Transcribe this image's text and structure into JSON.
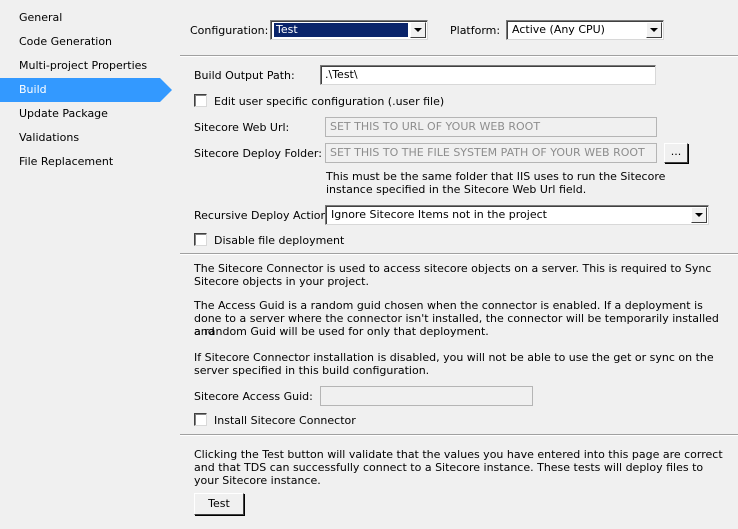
{
  "nav": {
    "items": [
      {
        "label": "General"
      },
      {
        "label": "Code Generation"
      },
      {
        "label": "Multi-project Properties"
      },
      {
        "label": "Build"
      },
      {
        "label": "Update Package"
      },
      {
        "label": "Validations"
      },
      {
        "label": "File Replacement"
      }
    ],
    "selected": "Build"
  },
  "top": {
    "configuration_label": "Configuration:",
    "configuration_value": "Test",
    "platform_label": "Platform:",
    "platform_value": "Active (Any CPU)"
  },
  "build": {
    "output_path_label": "Build Output Path:",
    "output_path_value": ".\\Test\\",
    "edit_user_config_label": "Edit user specific configuration (.user file)",
    "edit_user_config_checked": false,
    "web_url_label": "Sitecore Web Url:",
    "web_url_placeholder": "SET THIS TO URL OF YOUR WEB ROOT",
    "deploy_folder_label": "Sitecore Deploy Folder:",
    "deploy_folder_placeholder": "SET THIS TO THE FILE SYSTEM PATH OF YOUR WEB ROOT",
    "browse_label": "...",
    "deploy_folder_note_1": "This must be the same folder that IIS uses to run the Sitecore",
    "deploy_folder_note_2": "instance specified in the Sitecore Web Url field.",
    "recursive_label": "Recursive Deploy Action:",
    "recursive_value": "Ignore Sitecore Items not in the project",
    "disable_deploy_label": "Disable file deployment",
    "disable_deploy_checked": false
  },
  "connector": {
    "para1_line1": "The Sitecore Connector is used to access sitecore objects on a server. This is required to Sync",
    "para1_line2": "Sitecore objects in your project.",
    "para2_line1": "The Access Guid is a random guid chosen when the connector is enabled. If a deployment is",
    "para2_line2": "done to a server where the connector isn't installed, the connector will be temporarily installed and",
    "para2_line3": "a random Guid will be used for only that deployment.",
    "para3_line1": "If Sitecore Connector installation is disabled, you will not be able to use the get or sync on the",
    "para3_line2": "server specified in this build configuration.",
    "access_guid_label": "Sitecore Access Guid:",
    "access_guid_value": "",
    "install_label": "Install Sitecore Connector",
    "install_checked": false
  },
  "test": {
    "line1": "Clicking the Test button will validate that the values you have entered into this page are correct",
    "line2": "and that TDS can successfully connect to a Sitecore instance. These tests will deploy files to",
    "line3": "your Sitecore instance.",
    "button_label": "Test"
  },
  "colors": {
    "nav_selected": "#3399ff",
    "combo_selected": "#0a246a",
    "background": "#f0f0f0"
  }
}
